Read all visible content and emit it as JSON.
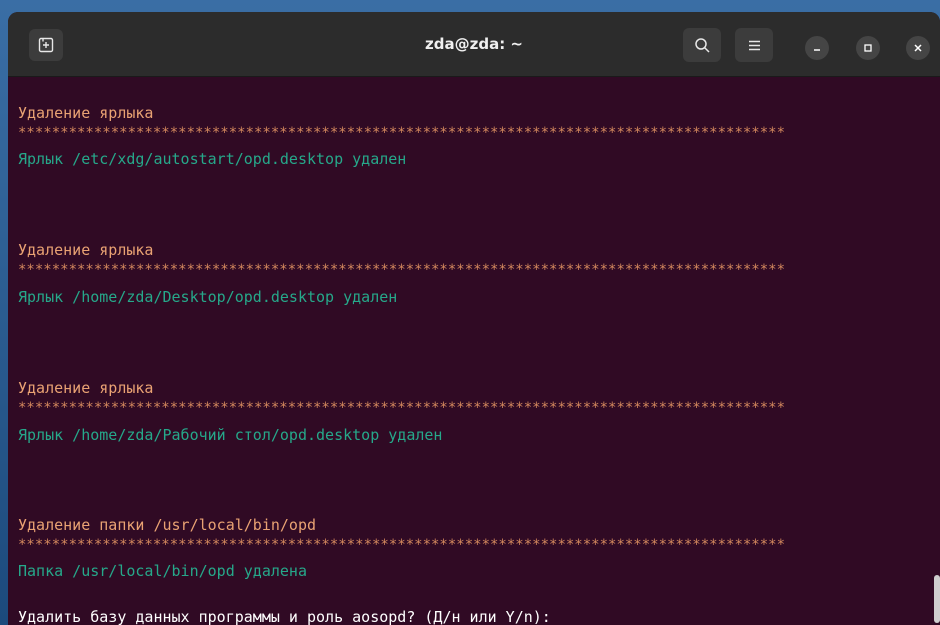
{
  "window": {
    "title": "zda@zda: ~"
  },
  "icons": {
    "new_tab": "new-tab-icon",
    "search": "search-icon",
    "menu": "hamburger-menu-icon",
    "minimize": "minimize-icon",
    "maximize": "maximize-icon",
    "close": "close-icon"
  },
  "colors": {
    "terminal_bg": "#300a24",
    "heading": "#e9a273",
    "success": "#26a88a",
    "prompt": "#ffffff",
    "titlebar": "#2c2c2c"
  },
  "terminal": {
    "blocks": [
      {
        "heading": "Удаление ярлыка",
        "stars": "*******************************************************************************************",
        "result": "Ярлык /etc/xdg/autostart/opd.desktop удален"
      },
      {
        "heading": "Удаление ярлыка",
        "stars": "*******************************************************************************************",
        "result": "Ярлык /home/zda/Desktop/opd.desktop удален"
      },
      {
        "heading": "Удаление ярлыка",
        "stars": "*******************************************************************************************",
        "result": "Ярлык /home/zda/Рабочий стол/opd.desktop удален"
      },
      {
        "heading": "Удаление папки /usr/local/bin/opd",
        "stars": "*******************************************************************************************",
        "result": "Папка /usr/local/bin/opd удалена"
      }
    ],
    "prompt": "Удалить базу данных программы и роль aosopd? (Д/н или Y/n):"
  }
}
